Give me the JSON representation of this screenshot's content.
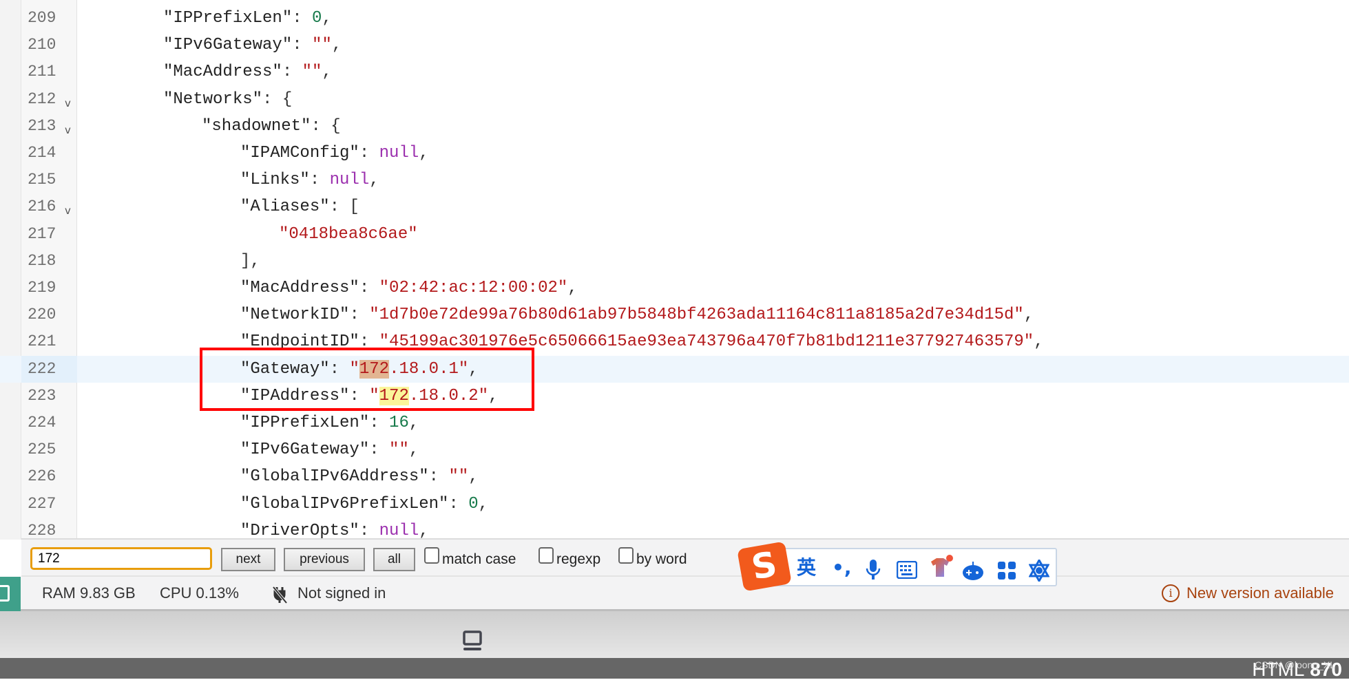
{
  "editor": {
    "lines": [
      {
        "no": "209",
        "indent": 2,
        "tokens": [
          [
            "k",
            "\"IPPrefixLen\""
          ],
          [
            "p",
            ": "
          ],
          [
            "num",
            "0"
          ],
          [
            "p",
            ","
          ]
        ]
      },
      {
        "no": "210",
        "indent": 2,
        "tokens": [
          [
            "k",
            "\"IPv6Gateway\""
          ],
          [
            "p",
            ": "
          ],
          [
            "s",
            "\"\""
          ],
          [
            "p",
            ","
          ]
        ]
      },
      {
        "no": "211",
        "indent": 2,
        "tokens": [
          [
            "k",
            "\"MacAddress\""
          ],
          [
            "p",
            ": "
          ],
          [
            "s",
            "\"\""
          ],
          [
            "p",
            ","
          ]
        ]
      },
      {
        "no": "212",
        "indent": 2,
        "fold": true,
        "tokens": [
          [
            "k",
            "\"Networks\""
          ],
          [
            "p",
            ": {"
          ]
        ]
      },
      {
        "no": "213",
        "indent": 3,
        "fold": true,
        "tokens": [
          [
            "k",
            "\"shadownet\""
          ],
          [
            "p",
            ": {"
          ]
        ]
      },
      {
        "no": "214",
        "indent": 4,
        "tokens": [
          [
            "k",
            "\"IPAMConfig\""
          ],
          [
            "p",
            ": "
          ],
          [
            "n",
            "null"
          ],
          [
            "p",
            ","
          ]
        ]
      },
      {
        "no": "215",
        "indent": 4,
        "tokens": [
          [
            "k",
            "\"Links\""
          ],
          [
            "p",
            ": "
          ],
          [
            "n",
            "null"
          ],
          [
            "p",
            ","
          ]
        ]
      },
      {
        "no": "216",
        "indent": 4,
        "fold": true,
        "tokens": [
          [
            "k",
            "\"Aliases\""
          ],
          [
            "p",
            ": ["
          ]
        ]
      },
      {
        "no": "217",
        "indent": 5,
        "tokens": [
          [
            "s",
            "\"0418bea8c6ae\""
          ]
        ]
      },
      {
        "no": "218",
        "indent": 4,
        "tokens": [
          [
            "p",
            "],"
          ]
        ]
      },
      {
        "no": "219",
        "indent": 4,
        "tokens": [
          [
            "k",
            "\"MacAddress\""
          ],
          [
            "p",
            ": "
          ],
          [
            "s",
            "\"02:42:ac:12:00:02\""
          ],
          [
            "p",
            ","
          ]
        ]
      },
      {
        "no": "220",
        "indent": 4,
        "tokens": [
          [
            "k",
            "\"NetworkID\""
          ],
          [
            "p",
            ": "
          ],
          [
            "s",
            "\"1d7b0e72de99a76b80d61ab97b5848bf4263ada11164c811a8185a2d7e34d15d\""
          ],
          [
            "p",
            ","
          ]
        ]
      },
      {
        "no": "221",
        "indent": 4,
        "tokens": [
          [
            "k",
            "\"EndpointID\""
          ],
          [
            "p",
            ": "
          ],
          [
            "s",
            "\"45199ac301976e5c65066615ae93ea743796a470f7b81bd1211e377927463579\""
          ],
          [
            "p",
            ","
          ]
        ]
      },
      {
        "no": "222",
        "indent": 4,
        "active": true,
        "tokens": [
          [
            "k",
            "\"Gateway\""
          ],
          [
            "p",
            ": "
          ],
          [
            "s",
            "\""
          ],
          [
            "hlc",
            "172"
          ],
          [
            "s",
            ".18.0.1\""
          ],
          [
            "p",
            ","
          ]
        ]
      },
      {
        "no": "223",
        "indent": 4,
        "tokens": [
          [
            "k",
            "\"IPAddress\""
          ],
          [
            "p",
            ": "
          ],
          [
            "s",
            "\""
          ],
          [
            "hl",
            "172"
          ],
          [
            "s",
            ".18.0.2\""
          ],
          [
            "p",
            ","
          ]
        ]
      },
      {
        "no": "224",
        "indent": 4,
        "tokens": [
          [
            "k",
            "\"IPPrefixLen\""
          ],
          [
            "p",
            ": "
          ],
          [
            "num",
            "16"
          ],
          [
            "p",
            ","
          ]
        ]
      },
      {
        "no": "225",
        "indent": 4,
        "tokens": [
          [
            "k",
            "\"IPv6Gateway\""
          ],
          [
            "p",
            ": "
          ],
          [
            "s",
            "\"\""
          ],
          [
            "p",
            ","
          ]
        ]
      },
      {
        "no": "226",
        "indent": 4,
        "tokens": [
          [
            "k",
            "\"GlobalIPv6Address\""
          ],
          [
            "p",
            ": "
          ],
          [
            "s",
            "\"\""
          ],
          [
            "p",
            ","
          ]
        ]
      },
      {
        "no": "227",
        "indent": 4,
        "tokens": [
          [
            "k",
            "\"GlobalIPv6PrefixLen\""
          ],
          [
            "p",
            ": "
          ],
          [
            "num",
            "0"
          ],
          [
            "p",
            ","
          ]
        ]
      },
      {
        "no": "228",
        "indent": 4,
        "tokens": [
          [
            "k",
            "\"DriverOpts\""
          ],
          [
            "p",
            ": "
          ],
          [
            "n",
            "null"
          ],
          [
            "p",
            ","
          ]
        ]
      }
    ],
    "fold_glyph": "v"
  },
  "findbar": {
    "query": "172",
    "next_label": "next",
    "previous_label": "previous",
    "all_label": "all",
    "match_case_label": "match case",
    "regexp_label": "regexp",
    "by_word_label": "by word"
  },
  "ime": {
    "logo": "S",
    "lang": "英",
    "punct": "•,",
    "icons": [
      "microphone-icon",
      "keyboard-icon",
      "skin-icon",
      "gamepad-icon",
      "apps-icon",
      "settings-icon"
    ]
  },
  "status": {
    "ram": "RAM 9.83 GB",
    "cpu": "CPU 0.13%",
    "signin": "Not signed in",
    "new_version": "New version available",
    "colors": {
      "accent": "#3fa08a",
      "warning": "#a8430f"
    }
  },
  "bottom": {
    "html_label": "HTML",
    "count": "870",
    "watermark": "CSDN @loong_XL"
  }
}
